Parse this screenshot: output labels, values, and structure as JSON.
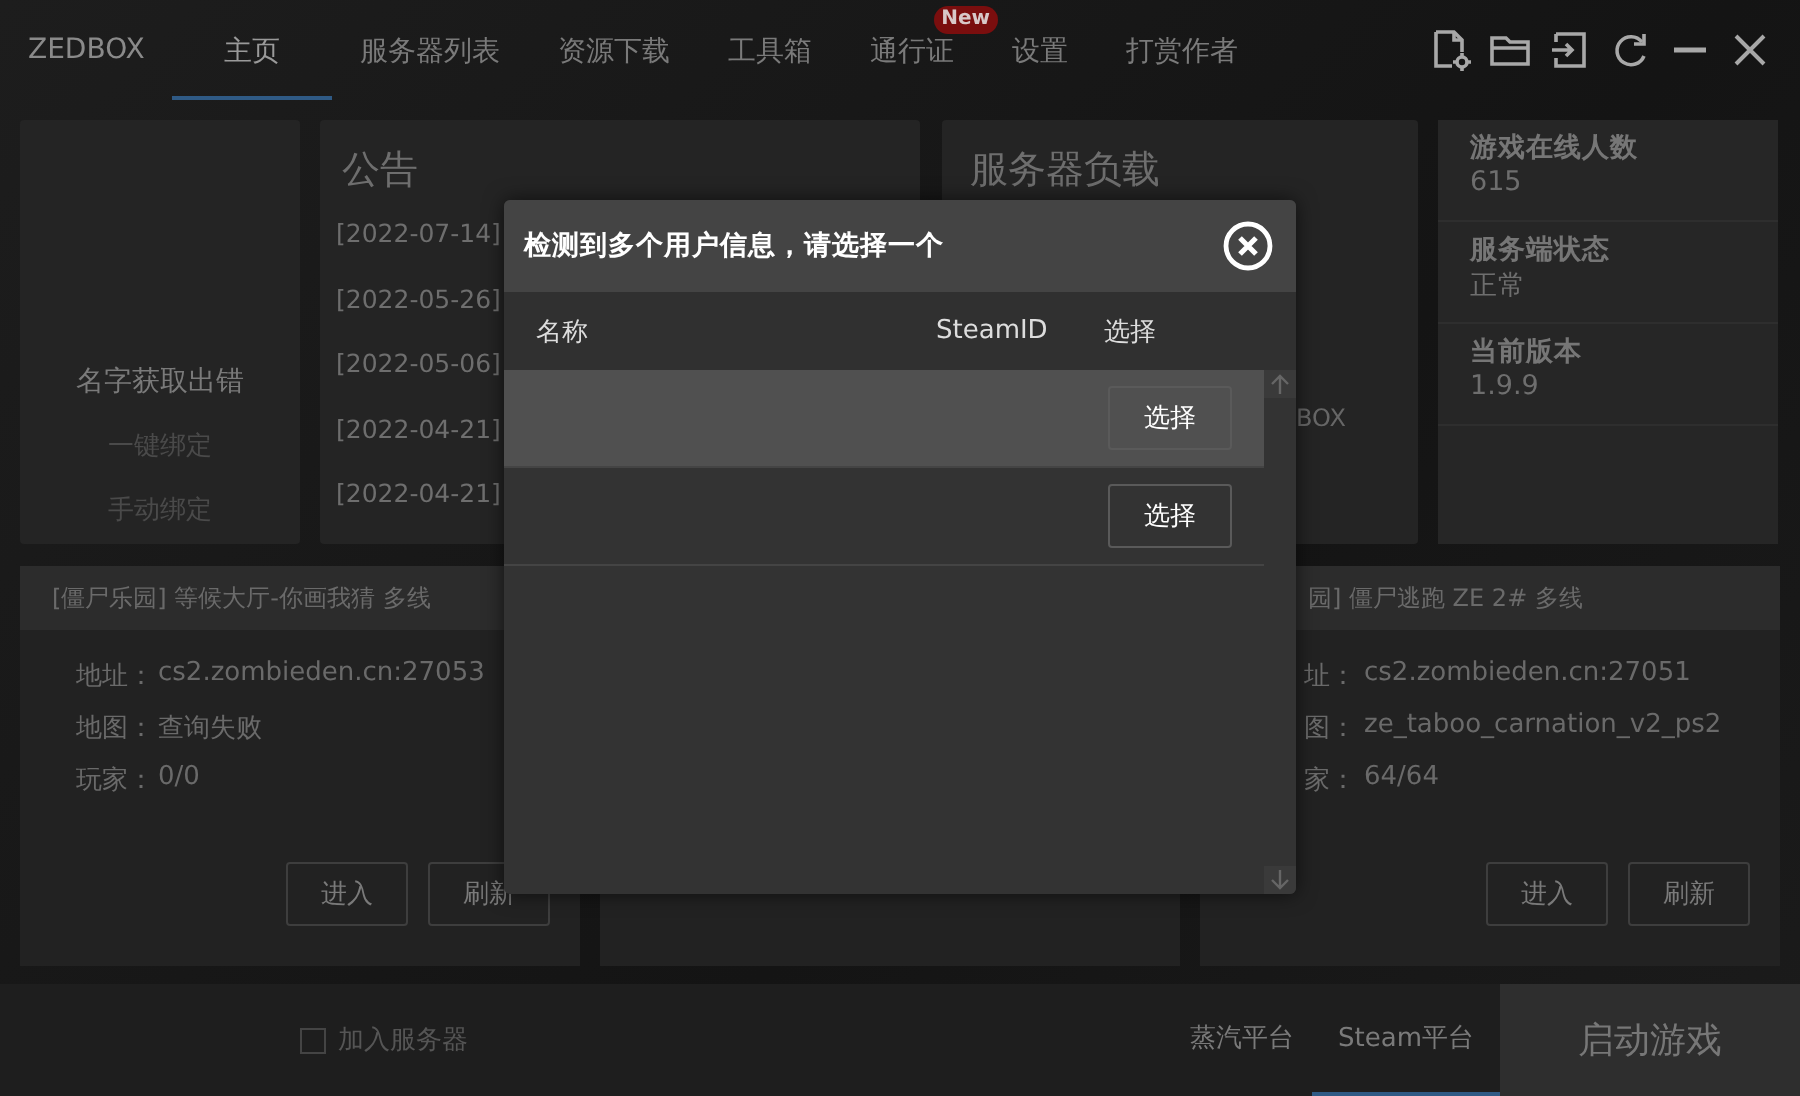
{
  "app": {
    "logo": "ZEDBOX"
  },
  "nav": [
    {
      "label": "主页",
      "selected": true
    },
    {
      "label": "服务器列表",
      "selected": false
    },
    {
      "label": "资源下载",
      "selected": false
    },
    {
      "label": "工具箱",
      "selected": false
    },
    {
      "label": "通行证",
      "selected": false,
      "badge": "New"
    },
    {
      "label": "设置",
      "selected": false
    },
    {
      "label": "打赏作者",
      "selected": false
    }
  ],
  "account": {
    "name": "名字获取出错",
    "links": [
      "一键绑定",
      "手动绑定"
    ]
  },
  "announcements": {
    "title": "公告",
    "items": [
      {
        "date": "[2022-07-14]"
      },
      {
        "date": "[2022-05-26]"
      },
      {
        "date": "[2022-05-06]"
      },
      {
        "date": "[2022-04-21]"
      },
      {
        "date": "[2022-04-21]"
      }
    ]
  },
  "server_load": {
    "title": "服务器负载",
    "fragments": [
      "BOX"
    ]
  },
  "stats": [
    {
      "label": "游戏在线人数",
      "value": "615"
    },
    {
      "label": "服务端状态",
      "value": "正常"
    },
    {
      "label": "当前版本",
      "value": "1.9.9"
    }
  ],
  "servers": [
    {
      "title": "[僵尸乐园] 等候大厅-你画我猜 多线",
      "fields": [
        {
          "label": "地址：",
          "value": "cs2.zombieden.cn:27053"
        },
        {
          "label": "地图：",
          "value": "查询失败"
        },
        {
          "label": "玩家：",
          "value": "0/0"
        }
      ],
      "buttons": [
        "进入",
        "刷新"
      ]
    },
    {
      "title": "园] 僵尸逃跑 ZE 2# 多线",
      "fields": [
        {
          "label": "址：",
          "value": "cs2.zombieden.cn:27051"
        },
        {
          "label": "图：",
          "value": "ze_taboo_carnation_v2_ps2"
        },
        {
          "label": "家：",
          "value": "64/64"
        }
      ],
      "buttons": [
        "进入",
        "刷新"
      ]
    }
  ],
  "bottom": {
    "join": {
      "label": "加入服务器",
      "checked": false
    },
    "platforms": [
      {
        "label": "蒸汽平台",
        "selected": false
      },
      {
        "label": "Steam平台",
        "selected": true
      }
    ],
    "launch": "启动游戏"
  },
  "dialog": {
    "title": "检测到多个用户信息，请选择一个",
    "columns": [
      "名称",
      "SteamID",
      "选择"
    ],
    "rows": [
      {
        "selected": true,
        "button": "选择"
      },
      {
        "selected": false,
        "button": "选择"
      }
    ]
  }
}
